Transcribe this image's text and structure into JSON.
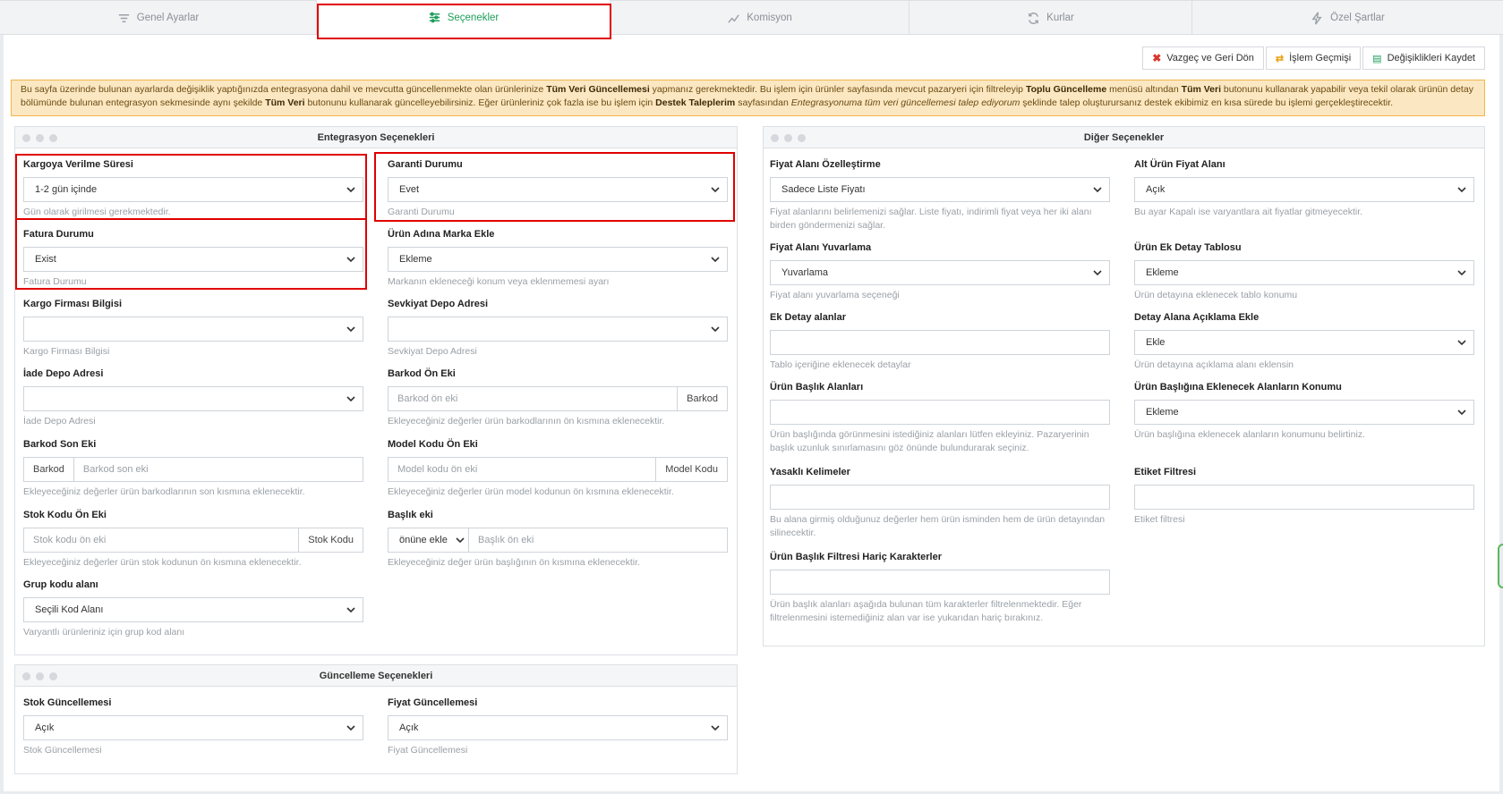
{
  "tabs": [
    {
      "label": "Genel Ayarlar",
      "icon": "sliders-lines-icon"
    },
    {
      "label": "Seçenekler",
      "icon": "settings-sliders-icon",
      "active": true
    },
    {
      "label": "Komisyon",
      "icon": "chart-line-icon"
    },
    {
      "label": "Kurlar",
      "icon": "refresh-currency-icon"
    },
    {
      "label": "Özel Şartlar",
      "icon": "bolt-icon"
    }
  ],
  "toolbar": {
    "cancel_label": "Vazgeç ve Geri Dön",
    "history_label": "İşlem Geçmişi",
    "save_label": "Değişiklikleri Kaydet"
  },
  "alert": {
    "p1": "Bu sayfa üzerinde bulunan ayarlarda değişiklik yaptığınızda entegrasyona dahil ve mevcutta güncellenmekte olan ürünlerinize ",
    "b1": "Tüm Veri Güncellemesi",
    "p2": " yapmanız gerekmektedir. Bu işlem için ürünler sayfasında mevcut pazaryeri için filtreleyip ",
    "b2": "Toplu Güncelleme",
    "p3": " menüsü altından ",
    "b3": "Tüm Veri",
    "p4": " butonunu kullanarak yapabilir veya tekil olarak ürünün detay bölümünde bulunan entegrasyon sekmesinde aynı şekilde ",
    "b4": "Tüm Veri",
    "p5": " butonunu kullanarak güncelleyebilirsiniz. Eğer ürünleriniz çok fazla ise bu işlem için ",
    "b5": "Destek Taleplerim",
    "p6": " sayfasından ",
    "i1": "Entegrasyonuma tüm veri güncellemesi talep ediyorum",
    "p7": " şeklinde talep oluşturursanız destek ekibimiz en kısa sürede bu işlemi gerçekleştirecektir."
  },
  "entegrasyon": {
    "title": "Entegrasyon Seçenekleri",
    "kargo_sure": {
      "label": "Kargoya Verilme Süresi",
      "value": "1-2 gün içinde",
      "help": "Gün olarak girilmesi gerekmektedir."
    },
    "garanti": {
      "label": "Garanti Durumu",
      "value": "Evet",
      "help": "Garanti Durumu"
    },
    "fatura": {
      "label": "Fatura Durumu",
      "value": "Exist",
      "help": "Fatura Durumu"
    },
    "marka": {
      "label": "Ürün Adına Marka Ekle",
      "value": "Ekleme",
      "help": "Markanın ekleneceği konum veya eklenmemesi ayarı"
    },
    "kargo_firma": {
      "label": "Kargo Firması Bilgisi",
      "value": "",
      "help": "Kargo Firması Bilgisi"
    },
    "sevkiyat": {
      "label": "Sevkiyat Depo Adresi",
      "value": "",
      "help": "Sevkiyat Depo Adresi"
    },
    "iade": {
      "label": "İade Depo Adresi",
      "value": "",
      "help": "İade Depo Adresi"
    },
    "barkod_on": {
      "label": "Barkod Ön Eki",
      "placeholder": "Barkod ön eki",
      "addon": "Barkod",
      "help": "Ekleyeceğiniz değerler ürün barkodlarının ön kısmına eklenecektir."
    },
    "barkod_son": {
      "label": "Barkod Son Eki",
      "placeholder": "Barkod son eki",
      "addon": "Barkod",
      "help": "Ekleyeceğiniz değerler ürün barkodlarının son kısmına eklenecektir."
    },
    "model_on": {
      "label": "Model Kodu Ön Eki",
      "placeholder": "Model kodu ön eki",
      "addon": "Model Kodu",
      "help": "Ekleyeceğiniz değerler ürün model kodunun ön kısmına eklenecektir."
    },
    "stok_on": {
      "label": "Stok Kodu Ön Eki",
      "placeholder": "Stok kodu ön eki",
      "addon": "Stok Kodu",
      "help": "Ekleyeceğiniz değerler ürün stok kodunun ön kısmına eklenecektir."
    },
    "baslik_eki": {
      "label": "Başlık eki",
      "select": "önüne ekle",
      "placeholder": "Başlık ön eki",
      "help": "Ekleyeceğiniz değer ürün başlığının ön kısmına eklenecektir."
    },
    "grup_kodu": {
      "label": "Grup kodu alanı",
      "value": "Seçili Kod Alanı",
      "help": "Varyantlı ürünleriniz için grup kod alanı"
    }
  },
  "guncelleme": {
    "title": "Güncelleme Seçenekleri",
    "stok": {
      "label": "Stok Güncellemesi",
      "value": "Açık",
      "help": "Stok Güncellemesi"
    },
    "fiyat": {
      "label": "Fiyat Güncellemesi",
      "value": "Açık",
      "help": "Fiyat Güncellemesi"
    }
  },
  "diger": {
    "title": "Diğer Seçenekler",
    "fiyat_alani": {
      "label": "Fiyat Alanı Özelleştirme",
      "value": "Sadece Liste Fiyatı",
      "help": "Fiyat alanlarını belirlemenizi sağlar. Liste fiyatı, indirimli fiyat veya her iki alanı birden göndermenizi sağlar."
    },
    "alt_urun": {
      "label": "Alt Ürün Fiyat Alanı",
      "value": "Açık",
      "help": "Bu ayar Kapalı ise varyantlara ait fiyatlar gitmeyecektir."
    },
    "yuvarlama": {
      "label": "Fiyat Alanı Yuvarlama",
      "value": "Yuvarlama",
      "help": "Fiyat alanı yuvarlama seçeneği"
    },
    "ek_detay_tablo": {
      "label": "Ürün Ek Detay Tablosu",
      "value": "Ekleme",
      "help": "Ürün detayına eklenecek tablo konumu"
    },
    "ek_detay": {
      "label": "Ek Detay alanlar",
      "value": "",
      "help": "Tablo içeriğine eklenecek detaylar"
    },
    "aciklama": {
      "label": "Detay Alana Açıklama Ekle",
      "value": "Ekle",
      "help": "Ürün detayına açıklama alanı eklensin"
    },
    "baslik_alanlari": {
      "label": "Ürün Başlık Alanları",
      "value": "",
      "help": "Ürün başlığında görünmesini istediğiniz alanları lütfen ekleyiniz. Pazaryerinin başlık uzunluk sınırlamasını göz önünde bulundurarak seçiniz."
    },
    "baslik_konum": {
      "label": "Ürün Başlığına Eklenecek Alanların Konumu",
      "value": "Ekleme",
      "help": "Ürün başlığına eklenecek alanların konumunu belirtiniz."
    },
    "yasakli": {
      "label": "Yasaklı Kelimeler",
      "value": "",
      "help": "Bu alana girmiş olduğunuz değerler hem ürün isminden hem de ürün detayından silinecektir."
    },
    "etiket": {
      "label": "Etiket Filtresi",
      "value": "",
      "help": "Etiket filtresi"
    },
    "haric": {
      "label": "Ürün Başlık Filtresi Hariç Karakterler",
      "value": "",
      "help": "Ürün başlık alanları aşağıda bulunan tüm karakterler filtrelenmektedir. Eğer filtrelenmesini istemediğiniz alan var ise yukarıdan hariç bırakınız."
    }
  }
}
